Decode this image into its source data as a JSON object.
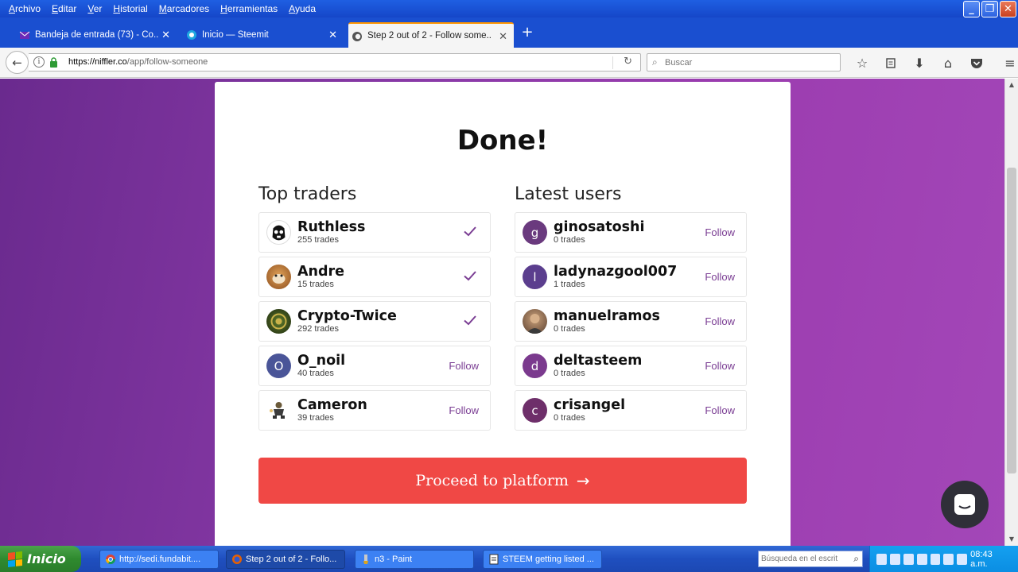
{
  "menu": {
    "items": [
      "Archivo",
      "Editar",
      "Ver",
      "Historial",
      "Marcadores",
      "Herramientas",
      "Ayuda"
    ]
  },
  "tabs": [
    {
      "title": "Bandeja de entrada (73) - Co...",
      "icon": "mail-icon",
      "active": false
    },
    {
      "title": "Inicio — Steemit",
      "icon": "steemit-icon",
      "active": false
    },
    {
      "title": "Step 2 out of 2 - Follow some...",
      "icon": "niffler-icon",
      "active": true
    }
  ],
  "nav": {
    "url_host": "https://niffler.co",
    "url_path": "/app/follow-someone",
    "search_placeholder": "Buscar"
  },
  "page": {
    "title": "Done!",
    "top_traders_title": "Top traders",
    "latest_users_title": "Latest users",
    "follow_label": "Follow",
    "proceed_label": "Proceed to platform",
    "accent_color": "#7a3d93",
    "button_color": "#f04845",
    "top_traders": [
      {
        "name": "Ruthless",
        "trades": "255 trades",
        "followed": true,
        "initial": ""
      },
      {
        "name": "Andre",
        "trades": "15 trades",
        "followed": true,
        "initial": ""
      },
      {
        "name": "Crypto-Twice",
        "trades": "292 trades",
        "followed": true,
        "initial": ""
      },
      {
        "name": "O_noil",
        "trades": "40 trades",
        "followed": false,
        "initial": "O"
      },
      {
        "name": "Cameron",
        "trades": "39 trades",
        "followed": false,
        "initial": ""
      }
    ],
    "latest_users": [
      {
        "name": "ginosatoshi",
        "trades": "0 trades",
        "followed": false,
        "initial": "g"
      },
      {
        "name": "ladynazgool007",
        "trades": "1 trades",
        "followed": false,
        "initial": "l"
      },
      {
        "name": "manuelramos",
        "trades": "0 trades",
        "followed": false,
        "initial": ""
      },
      {
        "name": "deltasteem",
        "trades": "0 trades",
        "followed": false,
        "initial": "d"
      },
      {
        "name": "crisangel",
        "trades": "0 trades",
        "followed": false,
        "initial": "c"
      }
    ]
  },
  "taskbar": {
    "start_label": "Inicio",
    "items": [
      {
        "title": "http://sedi.fundabit....",
        "icon": "chrome-icon",
        "active": false
      },
      {
        "title": "Step 2 out of 2 - Follo...",
        "icon": "firefox-icon",
        "active": true
      },
      {
        "title": "n3 - Paint",
        "icon": "paint-icon",
        "active": false
      },
      {
        "title": "STEEM getting listed ...",
        "icon": "document-icon",
        "active": false
      }
    ],
    "search_placeholder": "Búsqueda en el escrit",
    "clock": "08:43 a.m."
  }
}
